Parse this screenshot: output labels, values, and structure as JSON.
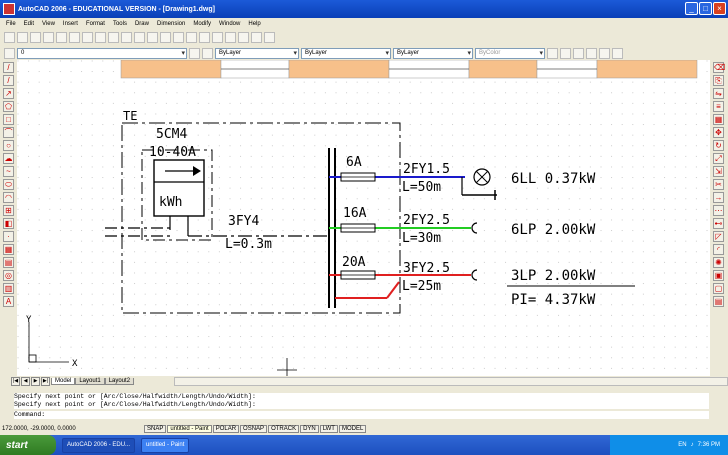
{
  "window": {
    "title": "AutoCAD 2006 - EDUCATIONAL VERSION - [Drawing1.dwg]"
  },
  "menu": [
    "File",
    "Edit",
    "View",
    "Insert",
    "Format",
    "Tools",
    "Draw",
    "Dimension",
    "Modify",
    "Window",
    "Help"
  ],
  "props": {
    "layer": "0",
    "color": "ByLayer",
    "linetype": "ByLayer",
    "lineweight": "ByLayer",
    "plotstyle": "ByColor"
  },
  "drawing": {
    "te": "TE",
    "meter_model": "5CM4",
    "meter_range": "10-40A",
    "meter_unit": "kWh",
    "main_cable": "3FY4",
    "main_length": "L=0.3m",
    "fuse1": "6A",
    "cable1": "2FY1.5",
    "len1": "L=50m",
    "load1": "6LL  0.37kW",
    "fuse2": "16A",
    "cable2": "2FY2.5",
    "len2": "L=30m",
    "load2": "6LP  2.00kW",
    "fuse3": "20A",
    "cable3": "3FY2.5",
    "len3": "L=25m",
    "load3": "3LP  2.00kW",
    "total": "PI=  4.37kW",
    "axis_x": "X",
    "axis_y": "Y",
    "line_colors": {
      "c1": "#1a1acc",
      "c2": "#22cc22",
      "c3": "#e02020"
    }
  },
  "tabs": [
    "Model",
    "Layout1",
    "Layout2"
  ],
  "command": [
    "Specify next point or [Arc/Close/Halfwidth/Length/Undo/Width]:",
    "Specify next point or [Arc/Close/Halfwidth/Length/Undo/Width]:",
    "Command:"
  ],
  "status": {
    "coords": "172.0000, -29.0000, 0.0000",
    "buttons": [
      "SNAP",
      "untitled - Paint",
      "POLAR",
      "OSNAP",
      "OTRACK",
      "DYN",
      "LWT",
      "MODEL"
    ]
  },
  "taskbar": {
    "start": "start",
    "items": [
      "AutoCAD 2006 - EDU...",
      "untitled - Paint"
    ],
    "lang": "EN",
    "clock": "7:36 PM"
  }
}
